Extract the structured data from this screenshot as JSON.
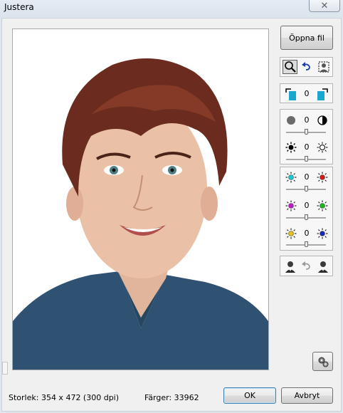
{
  "window": {
    "title": "Justera"
  },
  "buttons": {
    "open_file": "Öppna fil",
    "ok": "OK",
    "cancel": "Avbryt"
  },
  "adjustments": {
    "rotation": "0",
    "brightness": {
      "value": "0",
      "level": 0.5
    },
    "exposure": {
      "value": "0",
      "level": 0.5
    },
    "cyan_red": {
      "value": "0",
      "level": 0.5
    },
    "magenta_green": {
      "value": "0",
      "level": 0.5
    },
    "yellow_blue": {
      "value": "0",
      "level": 0.5
    }
  },
  "status": {
    "size": "Storlek: 354 x 472 (300 dpi)",
    "colors": "Färger: 33962"
  },
  "colors": {
    "cyan": "#17c9d6",
    "red": "#d21b1b",
    "magenta": "#c11ac9",
    "green": "#18b81d",
    "yellow": "#e6c312",
    "blue": "#1b28b8",
    "sweater": "#2d4f6e"
  }
}
